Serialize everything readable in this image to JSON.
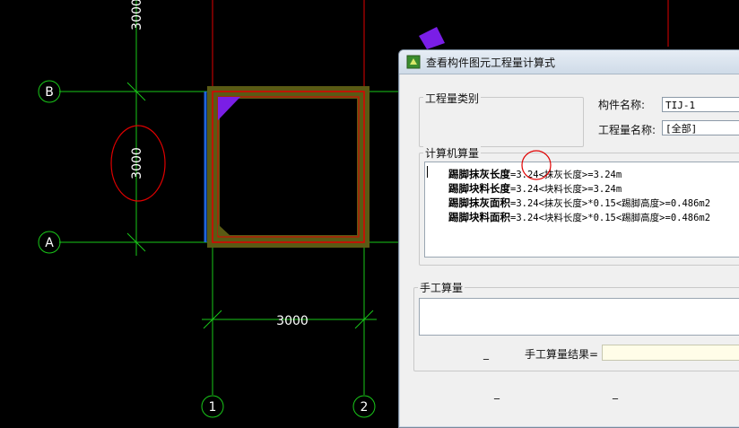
{
  "cad": {
    "axis_labels": [
      "B",
      "A",
      "1",
      "2"
    ],
    "dim_top": "3000",
    "dim_left": "3000",
    "dim_bottom": "3000"
  },
  "dialog": {
    "title": "查看构件图元工程量计算式",
    "quantity_category_label": "工程量类别",
    "component_name_label": "构件名称:",
    "component_name_value": "TIJ-1",
    "quantity_name_label": "工程量名称:",
    "quantity_name_value": "[全部]",
    "computer_calc_label": "计算机算量",
    "calc_lines": [
      {
        "name": "踢脚抹灰长度",
        "expr": "=3.24<抹灰长度>=3.24m"
      },
      {
        "name": "踢脚块料长度",
        "expr": "=3.24<块料长度>=3.24m"
      },
      {
        "name": "踢脚抹灰面积",
        "expr": "=3.24<抹灰长度>*0.15<踢脚高度>=0.486m2"
      },
      {
        "name": "踢脚块料面积",
        "expr": "=3.24<块料长度>*0.15<踢脚高度>=0.486m2"
      }
    ],
    "manual_calc_label": "手工算量",
    "manual_result_label": "手工算量结果=",
    "manual_result_value": "",
    "placeholder_dashes": [
      "_",
      "_",
      "_"
    ]
  },
  "colors": {
    "grid_green": "#19c819",
    "wall_red": "#e00000",
    "fill_olive": "#5a5a14",
    "accent_purple": "#7a1ee6",
    "annotation_red": "#e00000",
    "blue_edge": "#1e64dc"
  }
}
